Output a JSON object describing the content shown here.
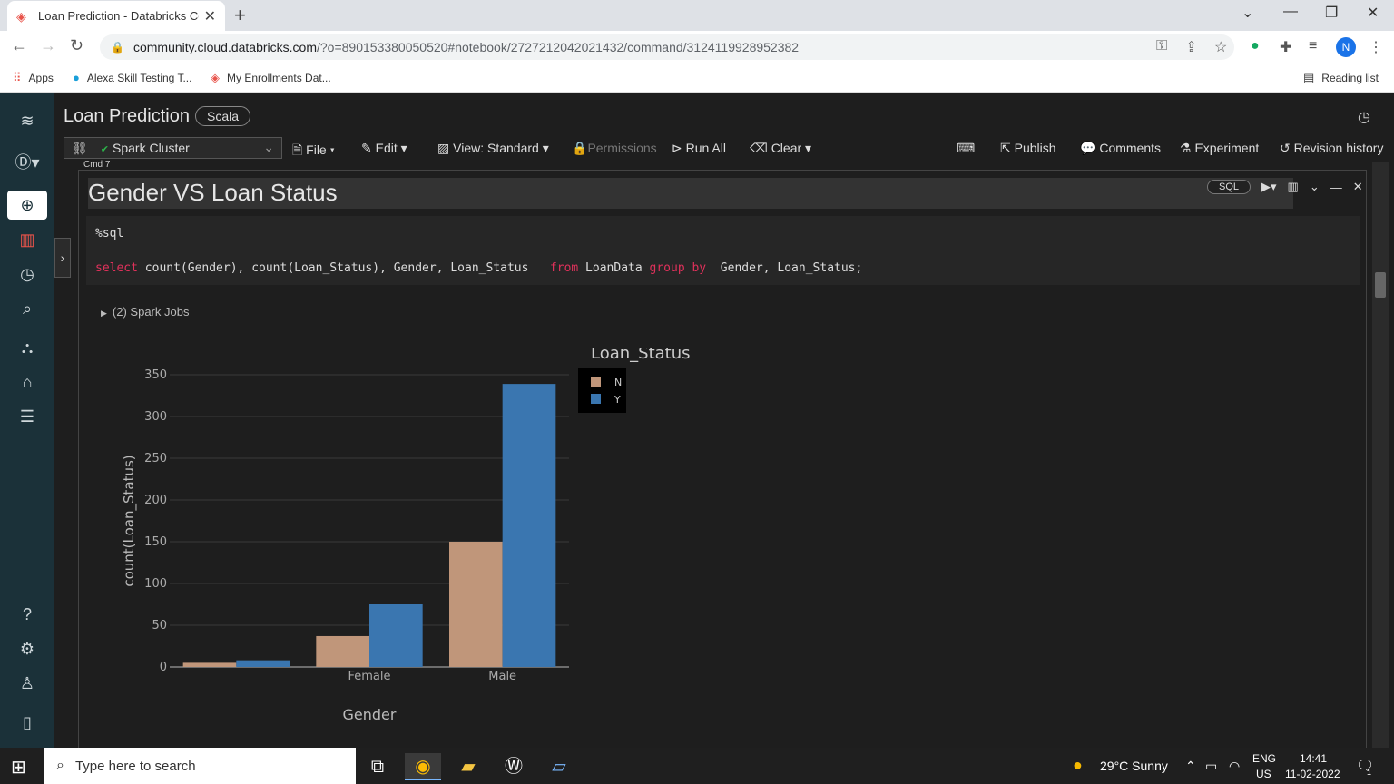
{
  "browser": {
    "tab_title": "Loan Prediction - Databricks Con",
    "url_host": "community.cloud.databricks.com",
    "url_path": "/?o=890153380050520#notebook/2727212042021432/command/3124119928952382",
    "profile_initial": "N",
    "bookmarks": [
      {
        "label": "Apps"
      },
      {
        "label": "Alexa Skill Testing T..."
      },
      {
        "label": "My Enrollments Dat..."
      }
    ],
    "reading_list": "Reading list"
  },
  "notebook": {
    "title": "Loan Prediction",
    "language": "Scala",
    "cluster": "Spark Cluster",
    "toolbar": {
      "file": "File",
      "edit": "Edit",
      "view": "View: Standard",
      "permissions": "Permissions",
      "run_all": "Run All",
      "clear": "Clear",
      "publish": "Publish",
      "comments": "Comments",
      "experiment": "Experiment",
      "revision_history": "Revision history"
    }
  },
  "cell": {
    "cmd_label": "Cmd 7",
    "markdown_title": "Gender VS Loan Status",
    "lang_pill": "SQL",
    "code_magic": "%sql",
    "code": {
      "select": "select",
      "cols": " count(Gender), count(Loan_Status), Gender, Loan_Status   ",
      "from": "from",
      "table": " LoanData ",
      "group_by": "group by",
      "tail": "  Gender, Loan_Status;"
    },
    "jobs": "(2) Spark Jobs"
  },
  "chart_data": {
    "type": "bar",
    "categories": [
      "",
      "Female",
      "Male"
    ],
    "series": [
      {
        "name": "N",
        "values": [
          5,
          37,
          150
        ],
        "color": "#c0967a"
      },
      {
        "name": "Y",
        "values": [
          8,
          75,
          339
        ],
        "color": "#3a76b0"
      }
    ],
    "xlabel": "Gender",
    "ylabel": "count(Loan_Status)",
    "legend_title": "Loan_Status",
    "legend_position": "top-right",
    "ylim": [
      0,
      350
    ],
    "yticks": [
      0,
      50,
      100,
      150,
      200,
      250,
      300,
      350
    ],
    "grid": true
  },
  "taskbar": {
    "search_placeholder": "Type here to search",
    "weather": "29°C  Sunny",
    "lang_top": "ENG",
    "lang_bottom": "US",
    "time": "14:41",
    "date": "11-02-2022",
    "notif_count": "1"
  }
}
